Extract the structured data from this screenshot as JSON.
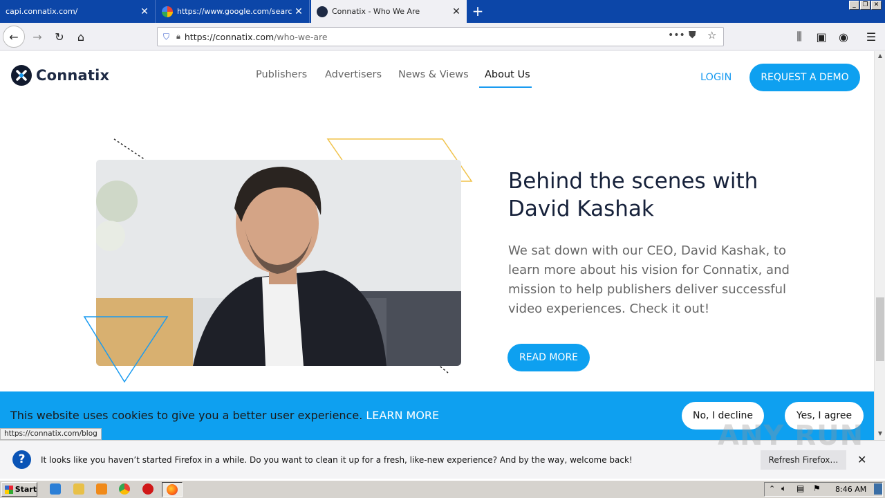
{
  "browser": {
    "tabs": [
      {
        "title": "capi.connatix.com/",
        "active": false
      },
      {
        "title": "https://www.google.com/search?",
        "active": false
      },
      {
        "title": "Connatix - Who We Are",
        "active": true
      }
    ],
    "url_host": "https://connatix.com",
    "url_path": "/who-we-are",
    "status_link": "https://connatix.com/blog"
  },
  "site": {
    "brand": "Connatix",
    "nav": [
      "Publishers",
      "Advertisers",
      "News & Views",
      "About Us"
    ],
    "active_nav": "About Us",
    "login_label": "LOGIN",
    "demo_label": "REQUEST A DEMO"
  },
  "feature": {
    "headline": "Behind the scenes with David Kashak",
    "body": "We sat down with our CEO, David Kashak, to learn more about his vision for Connatix, and mission to help publishers deliver successful video experiences. Check it out!",
    "cta": "READ MORE"
  },
  "cookie": {
    "message": "This website uses cookies to give you a better user experience.",
    "learn_more": "LEARN MORE",
    "decline": "No, I decline",
    "agree": "Yes, I agree"
  },
  "notification": {
    "text": "It looks like you haven’t started Firefox in a while. Do you want to clean it up for a fresh, like-new experience? And by the way, welcome back!",
    "button": "Refresh Firefox…"
  },
  "taskbar": {
    "start_label": "Start",
    "clock": "8:46 AM"
  },
  "watermark": "ANY RUN",
  "colors": {
    "accent": "#0ea0f0",
    "titlebar": "#0c46a8",
    "dark_text": "#16213a"
  }
}
